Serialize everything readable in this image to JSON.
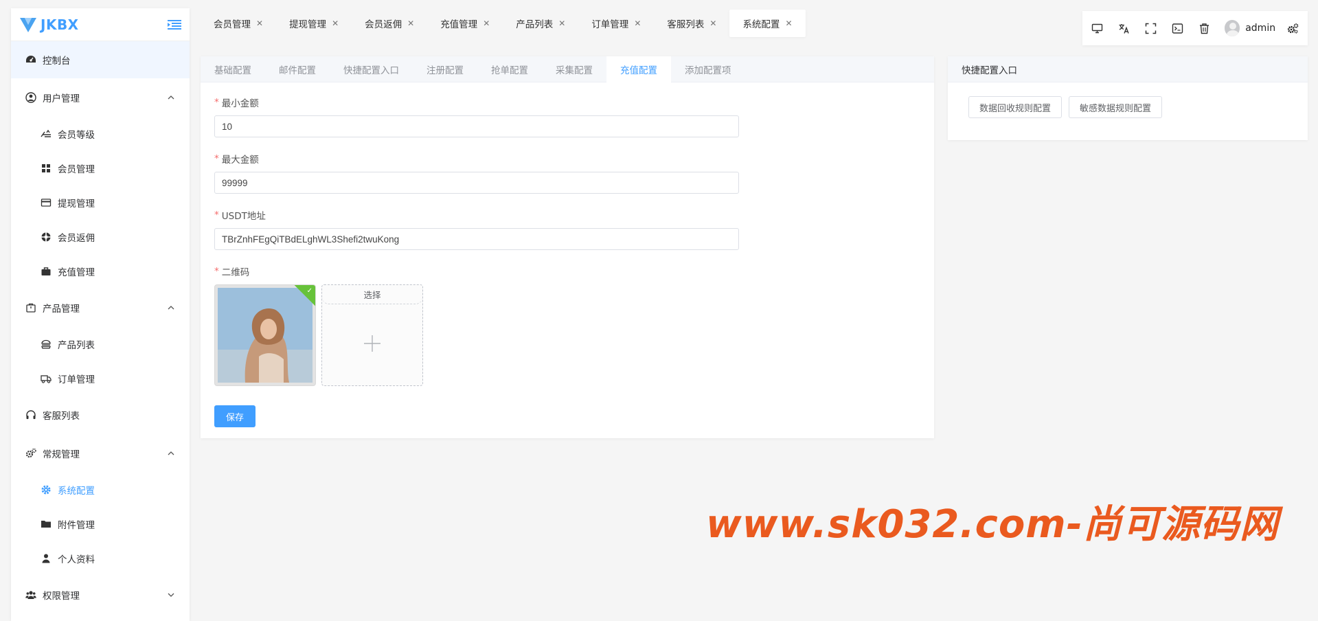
{
  "app": {
    "logo_text": "JKBX"
  },
  "sidebar": {
    "items": [
      {
        "label": "控制台",
        "icon": "dashboard-icon"
      },
      {
        "label": "用户管理",
        "icon": "user-circle-icon"
      },
      {
        "label": "会员等级",
        "icon": "level-icon"
      },
      {
        "label": "会员管理",
        "icon": "grid-icon"
      },
      {
        "label": "提现管理",
        "icon": "card-icon"
      },
      {
        "label": "会员返佣",
        "icon": "life-ring-icon"
      },
      {
        "label": "充值管理",
        "icon": "briefcase-icon"
      },
      {
        "label": "产品管理",
        "icon": "package-icon"
      },
      {
        "label": "产品列表",
        "icon": "burger-icon"
      },
      {
        "label": "订单管理",
        "icon": "truck-icon"
      },
      {
        "label": "客服列表",
        "icon": "headset-icon"
      },
      {
        "label": "常规管理",
        "icon": "cogs-icon"
      },
      {
        "label": "系统配置",
        "icon": "gear-icon"
      },
      {
        "label": "附件管理",
        "icon": "folder-icon"
      },
      {
        "label": "个人资料",
        "icon": "person-icon"
      },
      {
        "label": "权限管理",
        "icon": "users-icon"
      }
    ]
  },
  "tabs": [
    {
      "label": "会员管理"
    },
    {
      "label": "提现管理"
    },
    {
      "label": "会员返佣"
    },
    {
      "label": "充值管理"
    },
    {
      "label": "产品列表"
    },
    {
      "label": "订单管理"
    },
    {
      "label": "客服列表"
    },
    {
      "label": "系统配置"
    }
  ],
  "toolbar": {
    "username": "admin"
  },
  "config_tabs": [
    {
      "label": "基础配置"
    },
    {
      "label": "邮件配置"
    },
    {
      "label": "快捷配置入口"
    },
    {
      "label": "注册配置"
    },
    {
      "label": "抢单配置"
    },
    {
      "label": "采集配置"
    },
    {
      "label": "充值配置"
    },
    {
      "label": "添加配置项"
    }
  ],
  "form": {
    "min_amount": {
      "label": "最小金额",
      "value": "10"
    },
    "max_amount": {
      "label": "最大金额",
      "value": "99999"
    },
    "usdt": {
      "label": "USDT地址",
      "value": "TBrZnhFEgQiTBdELghWL3Shefi2twuKong"
    },
    "qrcode": {
      "label": "二维码",
      "picker_label": "选择"
    },
    "save_label": "保存"
  },
  "quick": {
    "title": "快捷配置入口",
    "buttons": [
      {
        "label": "数据回收规则配置"
      },
      {
        "label": "敏感数据规则配置"
      }
    ]
  },
  "watermark": "www.sk032.com-尚可源码网",
  "colors": {
    "primary": "#409eff",
    "required": "#f56c6c",
    "success_badge": "#67c23a",
    "watermark": "#ea5a1f"
  }
}
